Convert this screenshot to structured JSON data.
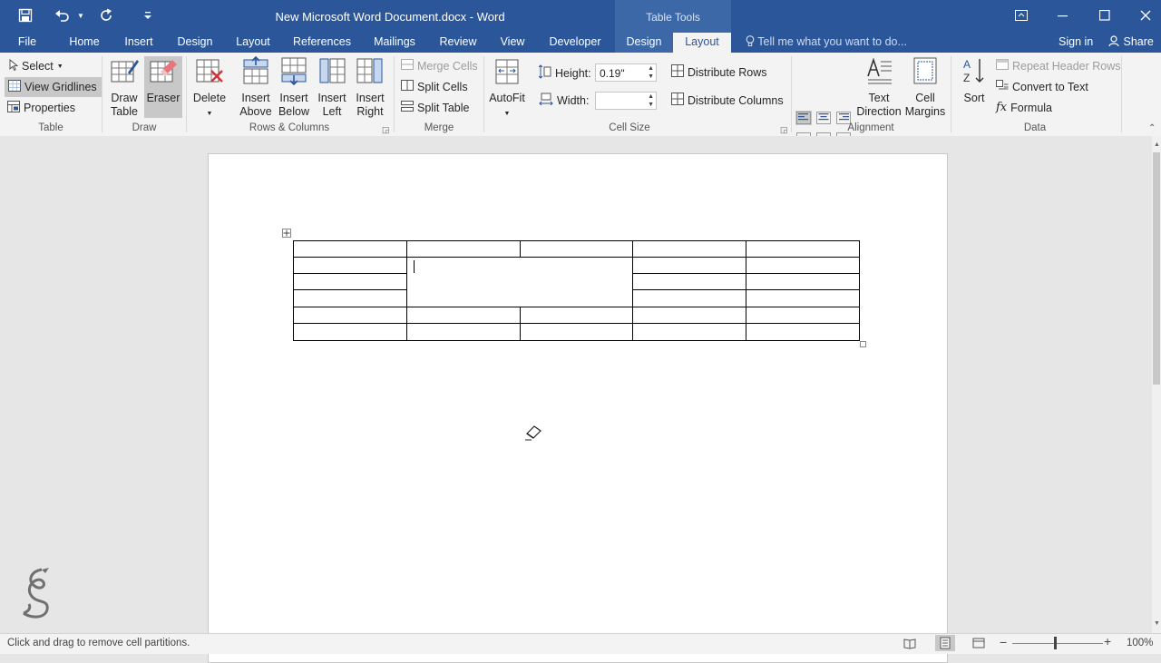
{
  "titlebar": {
    "document_title": "New Microsoft Word Document.docx - Word",
    "context_label": "Table Tools",
    "icons": [
      "save-icon",
      "undo-icon",
      "redo-icon",
      "customize-qat-icon",
      "ribbon-display-icon",
      "minimize-icon",
      "maximize-icon",
      "close-icon"
    ]
  },
  "tabs": [
    {
      "label": "File"
    },
    {
      "label": "Home"
    },
    {
      "label": "Insert"
    },
    {
      "label": "Design"
    },
    {
      "label": "Layout"
    },
    {
      "label": "References"
    },
    {
      "label": "Mailings"
    },
    {
      "label": "Review"
    },
    {
      "label": "View"
    },
    {
      "label": "Developer"
    },
    {
      "label": "Design"
    },
    {
      "label": "Layout"
    }
  ],
  "active_tab": "Layout",
  "tell_me": "Tell me what you want to do...",
  "sign_in": "Sign in",
  "share": "Share",
  "ribbon": {
    "table": {
      "select": "Select",
      "view_gridlines": "View Gridlines",
      "properties": "Properties",
      "label": "Table"
    },
    "draw": {
      "draw_table_1": "Draw",
      "draw_table_2": "Table",
      "eraser": "Eraser",
      "label": "Draw"
    },
    "rows_columns": {
      "delete": "Delete",
      "insert_above_1": "Insert",
      "insert_above_2": "Above",
      "insert_below_1": "Insert",
      "insert_below_2": "Below",
      "insert_left_1": "Insert",
      "insert_left_2": "Left",
      "insert_right_1": "Insert",
      "insert_right_2": "Right",
      "label": "Rows & Columns"
    },
    "merge": {
      "merge_cells": "Merge Cells",
      "split_cells": "Split Cells",
      "split_table": "Split Table",
      "label": "Merge"
    },
    "cell_size": {
      "autofit": "AutoFit",
      "height_label": "Height:",
      "height_value": "0.19\"",
      "width_label": "Width:",
      "width_value": "",
      "distribute_rows": "Distribute Rows",
      "distribute_columns": "Distribute Columns",
      "label": "Cell Size"
    },
    "alignment": {
      "text_direction_1": "Text",
      "text_direction_2": "Direction",
      "cell_margins_1": "Cell",
      "cell_margins_2": "Margins",
      "label": "Alignment"
    },
    "data": {
      "sort": "Sort",
      "repeat_header_rows": "Repeat Header Rows",
      "convert_to_text": "Convert to Text",
      "formula": "Formula",
      "label": "Data"
    }
  },
  "status": {
    "message": "Click and drag to remove cell partitions.",
    "zoom": "100%"
  },
  "colors": {
    "brand": "#2b579a",
    "ribbon_bg": "#f3f3f3",
    "canvas": "#e6e6e6"
  }
}
